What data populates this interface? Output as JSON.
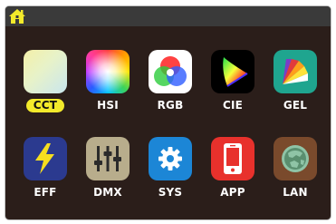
{
  "header": {
    "home_icon": "home-icon",
    "accent": "#f3ea2b"
  },
  "tiles": [
    {
      "id": "cct",
      "label": "CCT",
      "selected": true,
      "icon": "cct-icon"
    },
    {
      "id": "hsi",
      "label": "HSI",
      "selected": false,
      "icon": "hsi-icon"
    },
    {
      "id": "rgb",
      "label": "RGB",
      "selected": false,
      "icon": "rgb-icon"
    },
    {
      "id": "cie",
      "label": "CIE",
      "selected": false,
      "icon": "cie-icon"
    },
    {
      "id": "gel",
      "label": "GEL",
      "selected": false,
      "icon": "gel-icon"
    },
    {
      "id": "eff",
      "label": "EFF",
      "selected": false,
      "icon": "lightning-icon"
    },
    {
      "id": "dmx",
      "label": "DMX",
      "selected": false,
      "icon": "sliders-icon"
    },
    {
      "id": "sys",
      "label": "SYS",
      "selected": false,
      "icon": "gear-icon"
    },
    {
      "id": "app",
      "label": "APP",
      "selected": false,
      "icon": "smartphone-icon"
    },
    {
      "id": "lan",
      "label": "LAN",
      "selected": false,
      "icon": "globe-icon"
    }
  ]
}
